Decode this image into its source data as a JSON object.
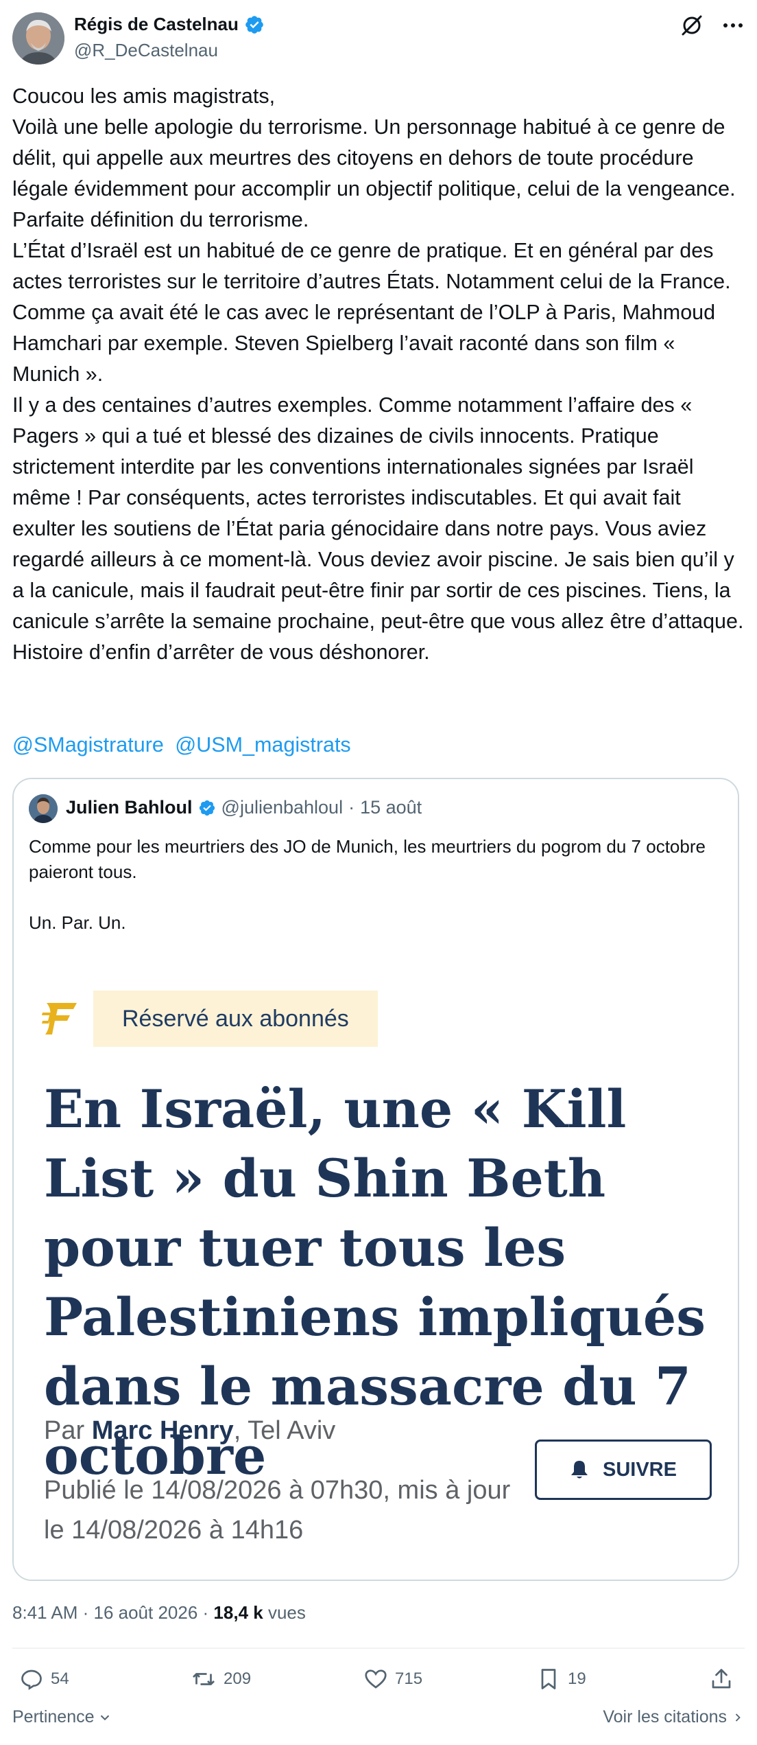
{
  "author": {
    "name": "Régis de Castelnau",
    "handle": "@R_DeCastelnau"
  },
  "tweet": {
    "text": "Coucou les amis magistrats,\nVoilà une belle apologie du terrorisme. Un personnage habitué à ce genre de délit, qui appelle aux meurtres des citoyens en dehors de toute procédure légale évidemment pour accomplir un objectif politique, celui de la vengeance. Parfaite définition du terrorisme.\nL’État d’Israël est un habitué de ce genre de pratique. Et en général par des actes terroristes sur le territoire d’autres États. Notamment celui de la France. Comme ça avait été le cas avec le représentant de l’OLP à Paris, Mahmoud Hamchari par exemple. Steven Spielberg l’avait raconté dans son film « Munich ».\nIl y a des centaines d’autres exemples. Comme notamment l’affaire des « Pagers » qui a tué et blessé des dizaines de civils innocents. Pratique strictement interdite par les conventions internationales signées par Israël même ! Par conséquents, actes terroristes indiscutables. Et qui avait fait exulter les soutiens de l’État paria génocidaire dans notre pays. Vous aviez regardé ailleurs à ce moment-là. Vous deviez avoir piscine. Je sais bien qu’il y a la canicule, mais il faudrait peut-être finir par sortir de ces piscines. Tiens, la canicule s’arrête la semaine prochaine, peut-être que vous allez être d’attaque.\nHistoire d’enfin d’arrêter de vous déshonorer.",
    "mentions": [
      "@SMagistrature",
      "@USM_magistrats"
    ]
  },
  "quoted": {
    "name": "Julien Bahloul",
    "handle": "@julienbahloul",
    "separator": "·",
    "date": "15 août",
    "text": "Comme pour les meurtriers des JO de Munich, les meurtriers du pogrom du 7 octobre paieront tous.\n\nUn. Par. Un.",
    "article": {
      "badge": "Réservé aux abonnés",
      "headline": "En Israël, une « Kill List » du Shin Beth pour tuer tous les Palestiniens impliqués dans le massacre du 7 octobre",
      "byline_prefix": "Par ",
      "byline_author": "Marc Henry",
      "byline_suffix": ", Tel Aviv",
      "published": "Publié le 14/08/2026 à 07h30, mis à jour le 14/08/2026 à 14h16",
      "follow_label": "SUIVRE"
    }
  },
  "meta": {
    "time_date": "8:41 AM · 16 août 2026 · ",
    "views_count": "18,4 k",
    "views_label": " vues"
  },
  "actions": {
    "replies": "54",
    "reposts": "209",
    "likes": "715",
    "bookmarks": "19"
  },
  "footer": {
    "sort_label": "Pertinence",
    "quotes_link": "Voir les citations"
  },
  "colors": {
    "link": "#1d9bf0",
    "verified": "#1d9bf0",
    "headline": "#1e3557",
    "badge_bg": "#fdf2d6",
    "figaro_gold": "#e8b21e"
  },
  "icons": [
    "verified-icon",
    "grok-icon",
    "more-icon",
    "figaro-logo-icon",
    "bell-icon",
    "reply-icon",
    "repost-icon",
    "like-icon",
    "bookmark-icon",
    "share-icon",
    "chevron-down-icon",
    "chevron-right-icon"
  ]
}
